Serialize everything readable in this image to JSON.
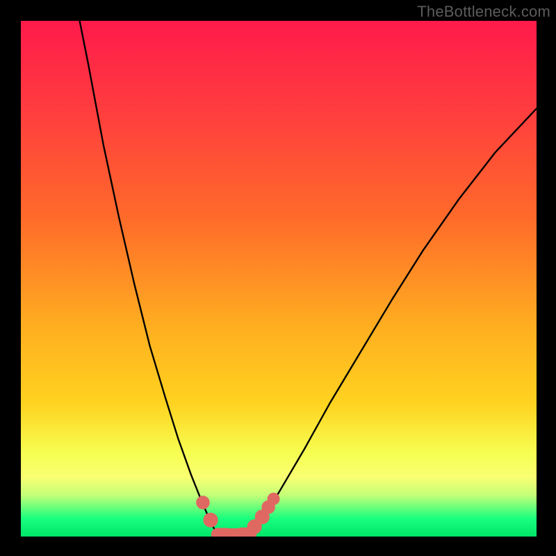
{
  "watermark": "TheBottleneck.com",
  "gradient": {
    "top": "#ff1a4b",
    "mid1": "#ff6a2a",
    "mid2": "#ffd21f",
    "band_top": "#f9ff72",
    "band_bottom": "#19ff7e",
    "bottom": "#00e46a"
  },
  "chart_data": {
    "type": "line",
    "title": "",
    "xlabel": "",
    "ylabel": "",
    "xlim": [
      0,
      100
    ],
    "ylim": [
      0,
      100
    ],
    "curve_left": [
      [
        11,
        102
      ],
      [
        13,
        92
      ],
      [
        16,
        76
      ],
      [
        19,
        62
      ],
      [
        22,
        49
      ],
      [
        25,
        37
      ],
      [
        28,
        27
      ],
      [
        30.5,
        19
      ],
      [
        33,
        12
      ],
      [
        35,
        7
      ],
      [
        36.5,
        3.5
      ],
      [
        37.5,
        1.5
      ],
      [
        38.5,
        0.5
      ],
      [
        39.5,
        0.15
      ]
    ],
    "curve_right": [
      [
        42.5,
        0.15
      ],
      [
        43.5,
        0.5
      ],
      [
        45,
        1.5
      ],
      [
        47,
        4
      ],
      [
        50,
        8.5
      ],
      [
        55,
        17
      ],
      [
        60,
        26
      ],
      [
        66,
        36
      ],
      [
        72,
        46
      ],
      [
        78,
        55.5
      ],
      [
        85,
        65.5
      ],
      [
        92,
        74.5
      ],
      [
        100,
        83
      ]
    ],
    "flat_segment": {
      "x0": 39.5,
      "x1": 42.5,
      "y": 0.15
    },
    "markers": [
      {
        "x": 35.3,
        "y": 6.6,
        "r": 1.2
      },
      {
        "x": 36.8,
        "y": 3.2,
        "r": 1.3
      },
      {
        "x": 39.0,
        "y": 0.4,
        "r": 1.4,
        "elong": true
      },
      {
        "x": 41.3,
        "y": 0.25,
        "r": 1.5,
        "elong": true
      },
      {
        "x": 43.6,
        "y": 0.5,
        "r": 1.4,
        "elong": true
      },
      {
        "x": 45.3,
        "y": 1.9,
        "r": 1.3
      },
      {
        "x": 46.8,
        "y": 3.8,
        "r": 1.3
      },
      {
        "x": 48.0,
        "y": 5.7,
        "r": 1.2
      },
      {
        "x": 49.0,
        "y": 7.3,
        "r": 1.1
      }
    ],
    "marker_color": "#e06862",
    "line_color": "#000000"
  }
}
